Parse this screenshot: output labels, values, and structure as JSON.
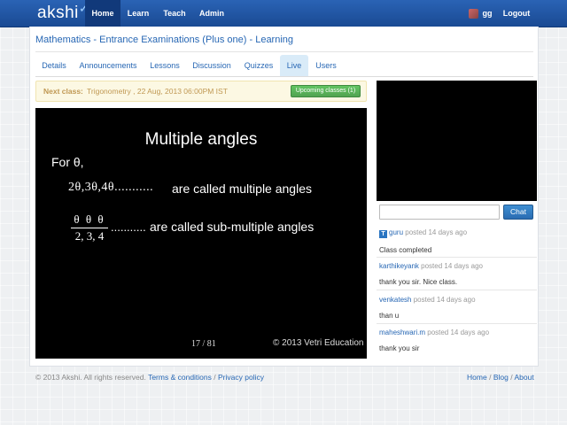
{
  "nav": {
    "brand": "akshi",
    "items": [
      "Home",
      "Learn",
      "Teach",
      "Admin"
    ],
    "active": "Home",
    "user": "gg",
    "logout": "Logout"
  },
  "page": {
    "title": "Mathematics - Entrance Examinations (Plus one) - Learning",
    "tabs": [
      "Details",
      "Announcements",
      "Lessons",
      "Discussion",
      "Quizzes",
      "Live",
      "Users"
    ],
    "active_tab": "Live"
  },
  "next_class": {
    "label": "Next class:",
    "text": "Trigonometry , 22 Aug, 2013 06:00PM IST",
    "upcoming_button": "Upcoming classes (1)"
  },
  "slide": {
    "heading": "Multiple angles",
    "intro": "For θ,",
    "line1_math": "2θ,3θ,4θ...........",
    "line1_text": "are called multiple angles",
    "frac_num": "θ θ θ",
    "frac_den": "2, 3, 4",
    "line2_dots": "...........",
    "line2_text": "are called sub-multiple  angles",
    "page": "17 / 81",
    "copyright": "© 2013 Vetri Education"
  },
  "chat": {
    "input_placeholder": "",
    "button": "Chat",
    "teacher_badge": "T",
    "messages": [
      {
        "user": "guru",
        "meta": " posted 14 days ago",
        "text": "Class completed",
        "teacher": true
      },
      {
        "user": "karthikeyank",
        "meta": " posted 14 days ago",
        "text": "thank you sir. Nice class.",
        "teacher": false
      },
      {
        "user": "venkatesh",
        "meta": " posted 14 days ago",
        "text": "than u",
        "teacher": false
      },
      {
        "user": "maheshwari.m",
        "meta": " posted 14 days ago",
        "text": "thank you sir",
        "teacher": false
      }
    ]
  },
  "footer": {
    "copyright": "© 2013 Akshi. All rights reserved.",
    "terms": "Terms & conditions",
    "separator": "/",
    "privacy": "Privacy policy",
    "links": [
      "Home",
      "Blog",
      "About"
    ]
  },
  "colors": {
    "navbar": "#1f57a6",
    "link": "#2767b4",
    "upcoming_button": "#5bb75b",
    "chat_button": "#3a87cf",
    "banner_bg": "#fcf8e3"
  }
}
